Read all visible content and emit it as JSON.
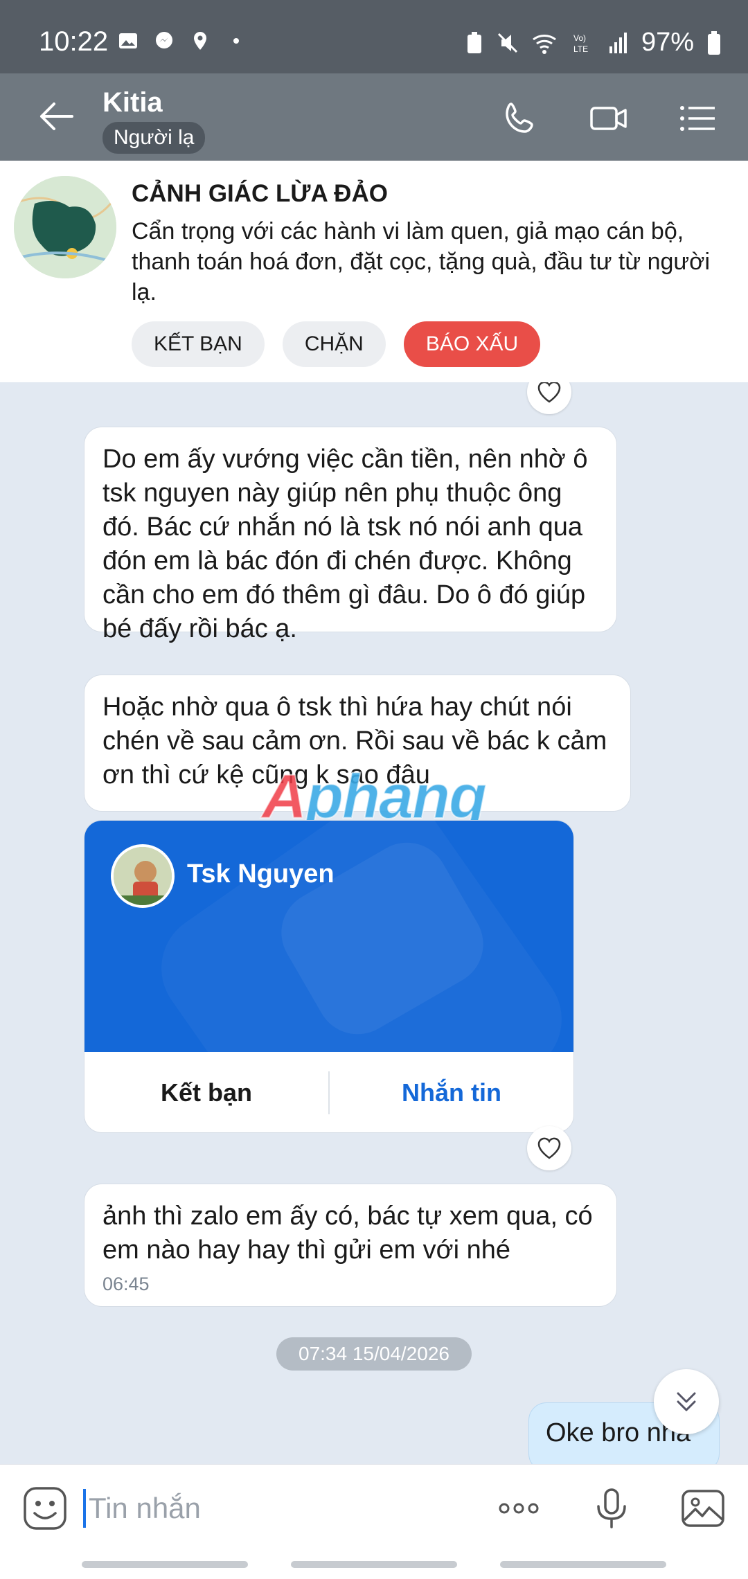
{
  "status_bar": {
    "time": "10:22",
    "battery": "97%"
  },
  "header": {
    "name": "Kitia",
    "tag": "Người lạ"
  },
  "warning": {
    "title": "CẢNH GIÁC LỪA ĐẢO",
    "body": "Cẩn trọng với các hành vi làm quen, giả mạo cán bộ, thanh toán hoá đơn, đặt cọc, tặng quà, đầu tư từ người lạ.",
    "buttons": {
      "add_friend": "KẾT BẠN",
      "block": "CHẶN",
      "report": "BÁO XẤU"
    }
  },
  "messages": {
    "m1": "Do em ấy vướng việc cần tiền, nên nhờ ô tsk nguyen này giúp nên phụ thuộc ông đó. Bác cứ nhắn nó là tsk nó nói anh qua đón em là bác đón đi chén được. Không cần cho em đó thêm gì đâu. Do ô đó giúp bé đấy rồi bác ạ.",
    "m2": "Hoặc nhờ qua ô tsk thì hứa hay chút nói chén về sau cảm ơn. Rồi sau về bác k cảm ơn thì cứ kệ cũng k sao đâu",
    "m3": "ảnh thì zalo em ấy có, bác tự xem qua, có em nào hay hay thì gửi em với nhé",
    "m3_time": "06:45",
    "date_divider": "07:34 15/04/2026",
    "outgoing": "Oke bro nha"
  },
  "contact_card": {
    "name": "Tsk Nguyen",
    "add_friend": "Kết bạn",
    "message": "Nhắn tin"
  },
  "watermark": {
    "part1": "A",
    "part2": "phang"
  },
  "input": {
    "placeholder": "Tin nhắn"
  },
  "colors": {
    "accent": "#1468d8",
    "report_red": "#e94e48",
    "header_gray": "#6f7880",
    "chat_bg": "#e2e9f2"
  }
}
